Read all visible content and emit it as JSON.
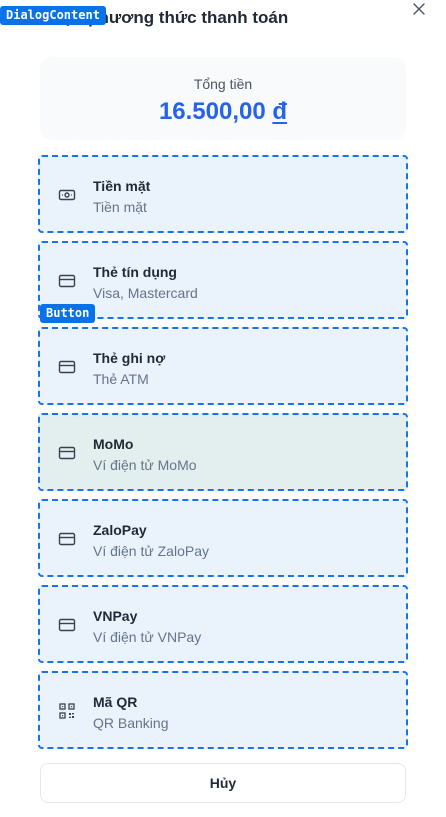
{
  "debug_labels": {
    "dialog": "DialogContent",
    "button": "Button"
  },
  "dialog": {
    "title": "Chọn phương thức thanh toán"
  },
  "total": {
    "label": "Tổng tiền",
    "amount": "16.500,00",
    "currency": "đ"
  },
  "methods": [
    {
      "name": "Tiền mặt",
      "desc": "Tiền mặt",
      "icon": "cash-icon"
    },
    {
      "name": "Thẻ tín dụng",
      "desc": "Visa, Mastercard",
      "icon": "credit-card-icon"
    },
    {
      "name": "Thẻ ghi nợ",
      "desc": "Thẻ ATM",
      "icon": "credit-card-icon"
    },
    {
      "name": "MoMo",
      "desc": "Ví điện tử MoMo",
      "icon": "credit-card-icon"
    },
    {
      "name": "ZaloPay",
      "desc": "Ví điện tử ZaloPay",
      "icon": "credit-card-icon"
    },
    {
      "name": "VNPay",
      "desc": "Ví điện tử VNPay",
      "icon": "credit-card-icon"
    },
    {
      "name": "Mã QR",
      "desc": "QR Banking",
      "icon": "qr-code-icon"
    }
  ],
  "cancel_label": "Hủy",
  "colors": {
    "accent": "#2563eb",
    "dashed_outline": "#1a73e8",
    "tag_bg": "#0a72e8"
  }
}
